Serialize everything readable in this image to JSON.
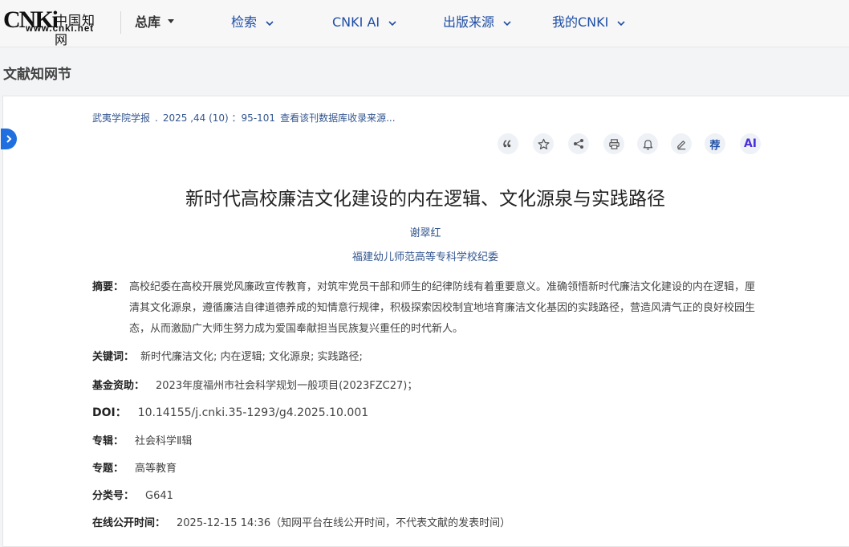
{
  "logo": {
    "brand": "CNKi",
    "chinese": "中国知网",
    "url": "www.cnki.net"
  },
  "nav": [
    {
      "label": "总库"
    },
    {
      "label": "检索"
    },
    {
      "label": "CNKI AI"
    },
    {
      "label": "出版来源"
    },
    {
      "label": "我的CNKI"
    }
  ],
  "section_title": "文献知网节",
  "source": {
    "journal": "武夷学院学报",
    "issue": "2025 ,44 (10) ：95-101",
    "link": "查看该刊数据库收录来源..."
  },
  "tools": [
    {
      "icon": "quote-icon"
    },
    {
      "icon": "star-icon"
    },
    {
      "icon": "share-icon"
    },
    {
      "icon": "print-icon"
    },
    {
      "icon": "bell-icon"
    },
    {
      "icon": "edit-icon"
    },
    {
      "icon": "recommend-icon",
      "label": "荐"
    },
    {
      "icon": "ai-icon",
      "label": "AI"
    }
  ],
  "article": {
    "title": "新时代高校廉洁文化建设的内在逻辑、文化源泉与实践路径",
    "author": "谢翠红",
    "organization": "福建幼儿师范高等专科学校纪委",
    "abstract_label": "摘要：",
    "abstract": "高校纪委在高校开展党风廉政宣传教育，对筑牢党员干部和师生的纪律防线有着重要意义。准确领悟新时代廉洁文化建设的内在逻辑，厘清其文化源泉，遵循廉洁自律道德养成的知情意行规律，积极探索因校制宜地培育廉洁文化基因的实践路径，营造风清气正的良好校园生态，从而激励广大师生努力成为爱国奉献担当民族复兴重任的时代新人。",
    "keywords_label": "关键词：",
    "keywords": "新时代廉洁文化;  内在逻辑;  文化源泉;  实践路径;",
    "fund_label": "基金资助：",
    "fund": "2023年度福州市社会科学规划一般项目(2023FZC27)；",
    "doi_label": "DOI：",
    "doi": "10.14155/j.cnki.35-1293/g4.2025.10.001",
    "series_label": "专辑：",
    "series": "社会科学Ⅱ辑",
    "subject_label": "专题：",
    "subject": "高等教育",
    "class_label": "分类号：",
    "class": "G641",
    "online_label": "在线公开时间：",
    "online": "2025-12-15 14:36（知网平台在线公开时间，不代表文献的发表时间）"
  }
}
